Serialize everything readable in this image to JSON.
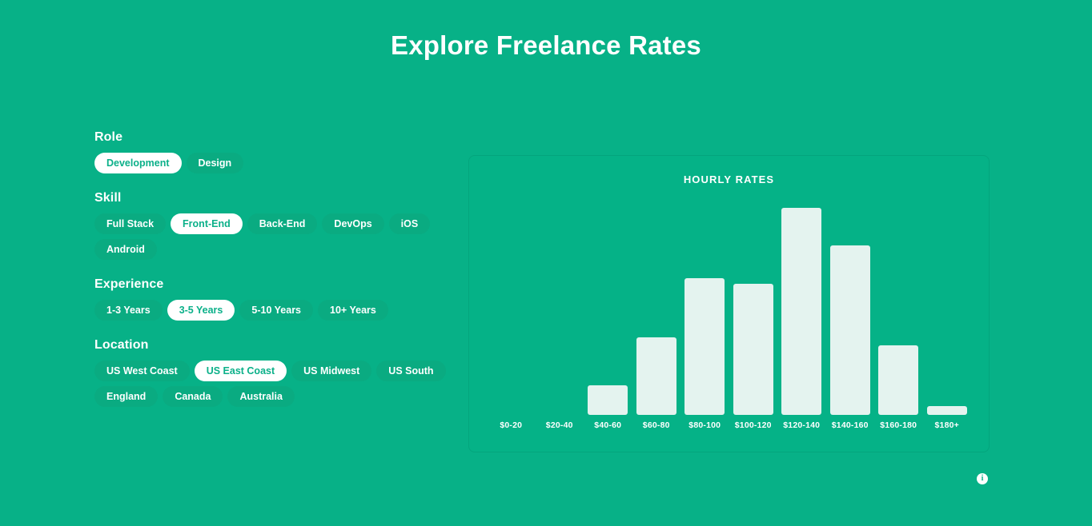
{
  "page": {
    "title": "Explore Freelance Rates",
    "background_color": "#07b187",
    "accent_color": "#ffffff",
    "pill_color": "#0aab81",
    "bar_color": "#e4f3ef"
  },
  "filters": [
    {
      "label": "Role",
      "options": [
        {
          "label": "Development",
          "selected": true
        },
        {
          "label": "Design",
          "selected": false
        }
      ]
    },
    {
      "label": "Skill",
      "options": [
        {
          "label": "Full Stack",
          "selected": false
        },
        {
          "label": "Front-End",
          "selected": true
        },
        {
          "label": "Back-End",
          "selected": false
        },
        {
          "label": "DevOps",
          "selected": false
        },
        {
          "label": "iOS",
          "selected": false
        },
        {
          "label": "Android",
          "selected": false
        }
      ]
    },
    {
      "label": "Experience",
      "options": [
        {
          "label": "1-3 Years",
          "selected": false
        },
        {
          "label": "3-5 Years",
          "selected": true
        },
        {
          "label": "5-10 Years",
          "selected": false
        },
        {
          "label": "10+ Years",
          "selected": false
        }
      ]
    },
    {
      "label": "Location",
      "options": [
        {
          "label": "US West Coast",
          "selected": false
        },
        {
          "label": "US East Coast",
          "selected": true
        },
        {
          "label": "US Midwest",
          "selected": false
        },
        {
          "label": "US South",
          "selected": false
        },
        {
          "label": "England",
          "selected": false
        },
        {
          "label": "Canada",
          "selected": false
        },
        {
          "label": "Australia",
          "selected": false
        }
      ]
    }
  ],
  "chart_data": {
    "type": "bar",
    "title": "HOURLY RATES",
    "xlabel": "",
    "ylabel": "",
    "grid": false,
    "legend": null,
    "categories": [
      "$0-20",
      "$20-40",
      "$40-60",
      "$60-80",
      "$80-100",
      "$100-120",
      "$120-140",
      "$140-160",
      "$160-180",
      "$180+"
    ],
    "values": [
      0,
      0,
      36,
      95,
      167,
      160,
      253,
      207,
      85,
      11
    ],
    "ylim": [
      0,
      260
    ],
    "value_units": "relative bar height (px)"
  },
  "info": {
    "icon": "info-icon",
    "glyph": "i"
  }
}
